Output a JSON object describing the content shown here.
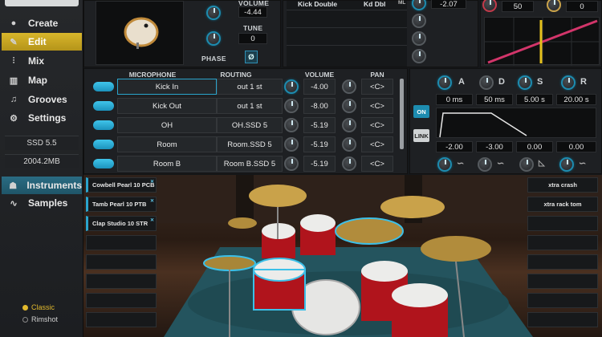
{
  "sidebar": {
    "nav": [
      {
        "label": "Create",
        "icon": "drum-icon"
      },
      {
        "label": "Edit",
        "icon": "tool-icon"
      },
      {
        "label": "Mix",
        "icon": "faders-icon"
      },
      {
        "label": "Map",
        "icon": "keyboard-icon"
      },
      {
        "label": "Grooves",
        "icon": "music-note-icon"
      },
      {
        "label": "Settings",
        "icon": "gear-icon"
      }
    ],
    "version": "SSD 5.5",
    "memory": "2004.2MB",
    "lower_nav": [
      {
        "label": "Instruments",
        "icon": "drumkit-icon"
      },
      {
        "label": "Samples",
        "icon": "waveform-icon"
      }
    ],
    "articulation": {
      "options": [
        "Classic",
        "Rimshot"
      ],
      "selected": "Classic"
    }
  },
  "instrument_panel": {
    "volume_label": "VOLUME",
    "volume_value": "-4.44",
    "tune_label": "TUNE",
    "tune_value": "0",
    "phase_label": "PHASE",
    "phase_value": "Ø"
  },
  "articulation_list": {
    "rows": [
      {
        "name": "Kick Double",
        "short": "Kd Dbl",
        "tag": "ML",
        "value": "-2.07"
      }
    ]
  },
  "velocity_panel": {
    "value1": "50",
    "value2": "0"
  },
  "mixer": {
    "headers": {
      "mic": "MICROPHONE",
      "routing": "ROUTING",
      "volume": "VOLUME",
      "pan": "PAN"
    },
    "rows": [
      {
        "mic": "Kick In",
        "routing": "out 1 st",
        "volume": "-4.00",
        "pan": "<C>",
        "active": true
      },
      {
        "mic": "Kick Out",
        "routing": "out 1 st",
        "volume": "-8.00",
        "pan": "<C>",
        "active": false
      },
      {
        "mic": "OH",
        "routing": "OH.SSD 5",
        "volume": "-5.19",
        "pan": "<C>",
        "active": false
      },
      {
        "mic": "Room",
        "routing": "Room.SSD 5",
        "volume": "-5.19",
        "pan": "<C>",
        "active": false
      },
      {
        "mic": "Room B",
        "routing": "Room B.SSD 5",
        "volume": "-5.19",
        "pan": "<C>",
        "active": false
      }
    ]
  },
  "envelope": {
    "labels": [
      "A",
      "D",
      "S",
      "R"
    ],
    "times": [
      "0 ms",
      "50 ms",
      "5.00 s",
      "20.00 s"
    ],
    "on_label": "ON",
    "link_label": "LINK",
    "bottom_values": [
      "-2.00",
      "-3.00",
      "0.00",
      "0.00"
    ]
  },
  "slots_left": [
    {
      "label": "Cowbell Pearl 10 PCB"
    },
    {
      "label": "Tamb Pearl 10 PTB"
    },
    {
      "label": "Clap Studio 10 STR"
    },
    {
      "label": ""
    },
    {
      "label": ""
    },
    {
      "label": ""
    },
    {
      "label": ""
    },
    {
      "label": ""
    }
  ],
  "slots_right": [
    {
      "label": "xtra crash"
    },
    {
      "label": "xtra rack tom"
    },
    {
      "label": ""
    },
    {
      "label": ""
    },
    {
      "label": ""
    },
    {
      "label": ""
    },
    {
      "label": ""
    },
    {
      "label": ""
    }
  ],
  "colors": {
    "accent": "#1d8cb0",
    "active_nav": "#d8b62b",
    "drum_red": "#b0141c",
    "cymbal": "#c9a24a"
  }
}
